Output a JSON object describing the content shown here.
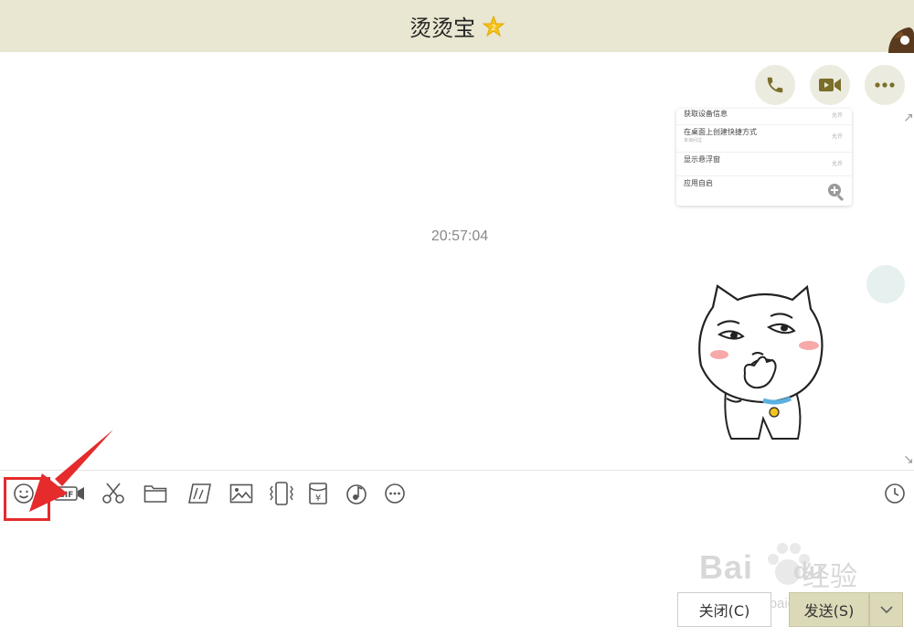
{
  "window": {
    "title": "烫烫宝"
  },
  "header_actions": {
    "phone_icon": "phone-icon",
    "video_icon": "video-icon",
    "more_icon": "more-icon"
  },
  "chat": {
    "screenshot_rows": [
      {
        "label": "获取设备信息",
        "sub": "",
        "value": "允许"
      },
      {
        "label": "在桌面上创建快捷方式",
        "sub": "未询问过",
        "value": "允许"
      },
      {
        "label": "显示悬浮窗",
        "sub": "",
        "value": "允许"
      },
      {
        "label": "应用自启",
        "sub": "",
        "value": ""
      }
    ],
    "timestamp": "20:57:04"
  },
  "toolbar": {
    "tools": [
      "emoji-icon",
      "gif-icon",
      "scissors-icon",
      "folder-icon",
      "screenshot-icon",
      "image-icon",
      "shake-icon",
      "red-packet-icon",
      "music-icon",
      "more-tools-icon"
    ],
    "history_icon": "clock-icon"
  },
  "input": {
    "value": ""
  },
  "footer": {
    "close_label": "关闭(C)",
    "send_label": "发送(S)"
  },
  "watermark": {
    "brand": "Bai",
    "brand2": "du",
    "label": "经验",
    "url": "jingyan.baidu.com"
  },
  "colors": {
    "titlebar": "#e9e6d1",
    "accent_olive": "#7a6e2a",
    "send_button": "#dcd9b9",
    "highlight_red": "#e52b2b"
  }
}
